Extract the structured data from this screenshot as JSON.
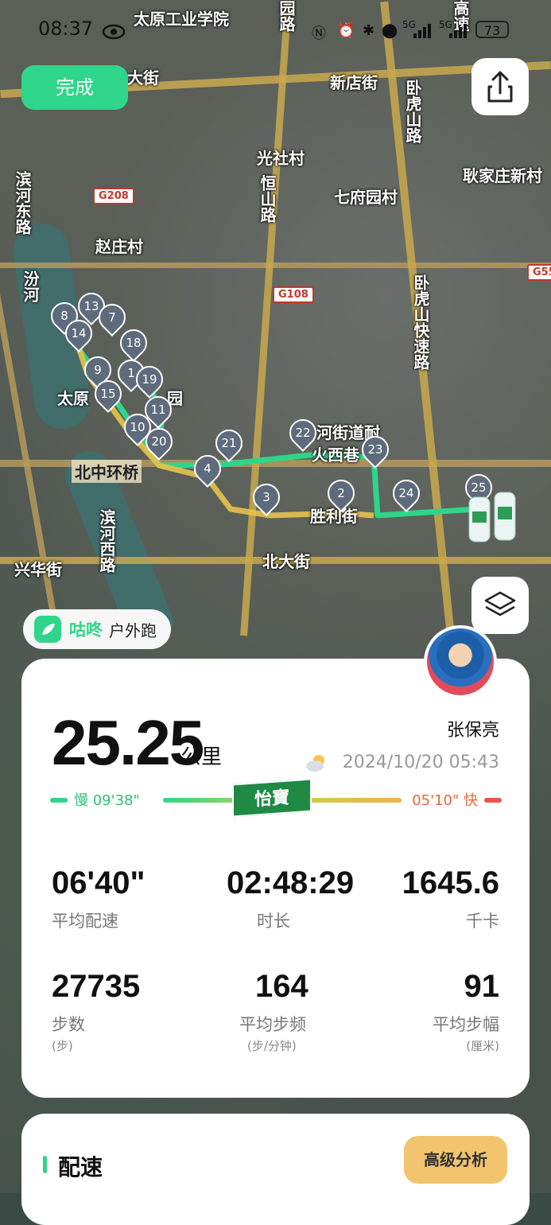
{
  "status_bar": {
    "time": "08:37",
    "battery": "73",
    "network1": "5G",
    "network2": "5G"
  },
  "map": {
    "labels": {
      "taiyuan_inst": "太原工业学院",
      "dajie": "大街",
      "xindian": "新店街",
      "wohu_n": "卧虎山路",
      "wohu_s": "卧虎山快速路",
      "guangshe": "光社村",
      "hengshan": "恒山路",
      "qifu": "七府园村",
      "gengjia": "耿家庄新村",
      "zhaozhuang": "赵庄村",
      "binhe_e": "滨河东路",
      "binhe_w": "滨河西路",
      "fenhe": "汾河",
      "beizhong": "北中环桥",
      "beidajie": "北大街",
      "xinghua": "兴华街",
      "xijie": "胜利街",
      "xianghe": "河街道耐",
      "xiangxi": "火西巷",
      "taiyuan_park": "太原",
      "park": "园",
      "g208": "G208",
      "g108": "G108",
      "g55": "G55",
      "yinyuan": "园路",
      "gaosu": "高速"
    },
    "pins": [
      "2",
      "3",
      "4",
      "8",
      "13",
      "7",
      "14",
      "18",
      "9",
      "1",
      "19",
      "15",
      "11",
      "10",
      "20",
      "21",
      "22",
      "23",
      "24",
      "25"
    ]
  },
  "buttons": {
    "done": "完成"
  },
  "brand": {
    "name": "咕咚",
    "sub": "户外跑"
  },
  "card": {
    "distance": "25.25",
    "distance_unit": "公里",
    "username": "张保亮",
    "datetime": "2024/10/20 05:43",
    "slow_label": "慢 09'38\"",
    "fast_label": "05'10\" 快",
    "sponsor": "怡寶",
    "stats": [
      {
        "value": "06'40\"",
        "label": "平均配速",
        "unit": ""
      },
      {
        "value": "02:48:29",
        "label": "时长",
        "unit": ""
      },
      {
        "value": "1645.6",
        "label": "千卡",
        "unit": ""
      },
      {
        "value": "27735",
        "label": "步数",
        "unit": "(步)"
      },
      {
        "value": "164",
        "label": "平均步频",
        "unit": "(步/分钟)"
      },
      {
        "value": "91",
        "label": "平均步幅",
        "unit": "(厘米)"
      }
    ]
  },
  "bottom": {
    "title": "配速",
    "analysis_button": "高级分析"
  },
  "colors": {
    "accent": "#2fd58a",
    "route_slow": "#2fd58a",
    "route_fast": "#e8c24a"
  }
}
